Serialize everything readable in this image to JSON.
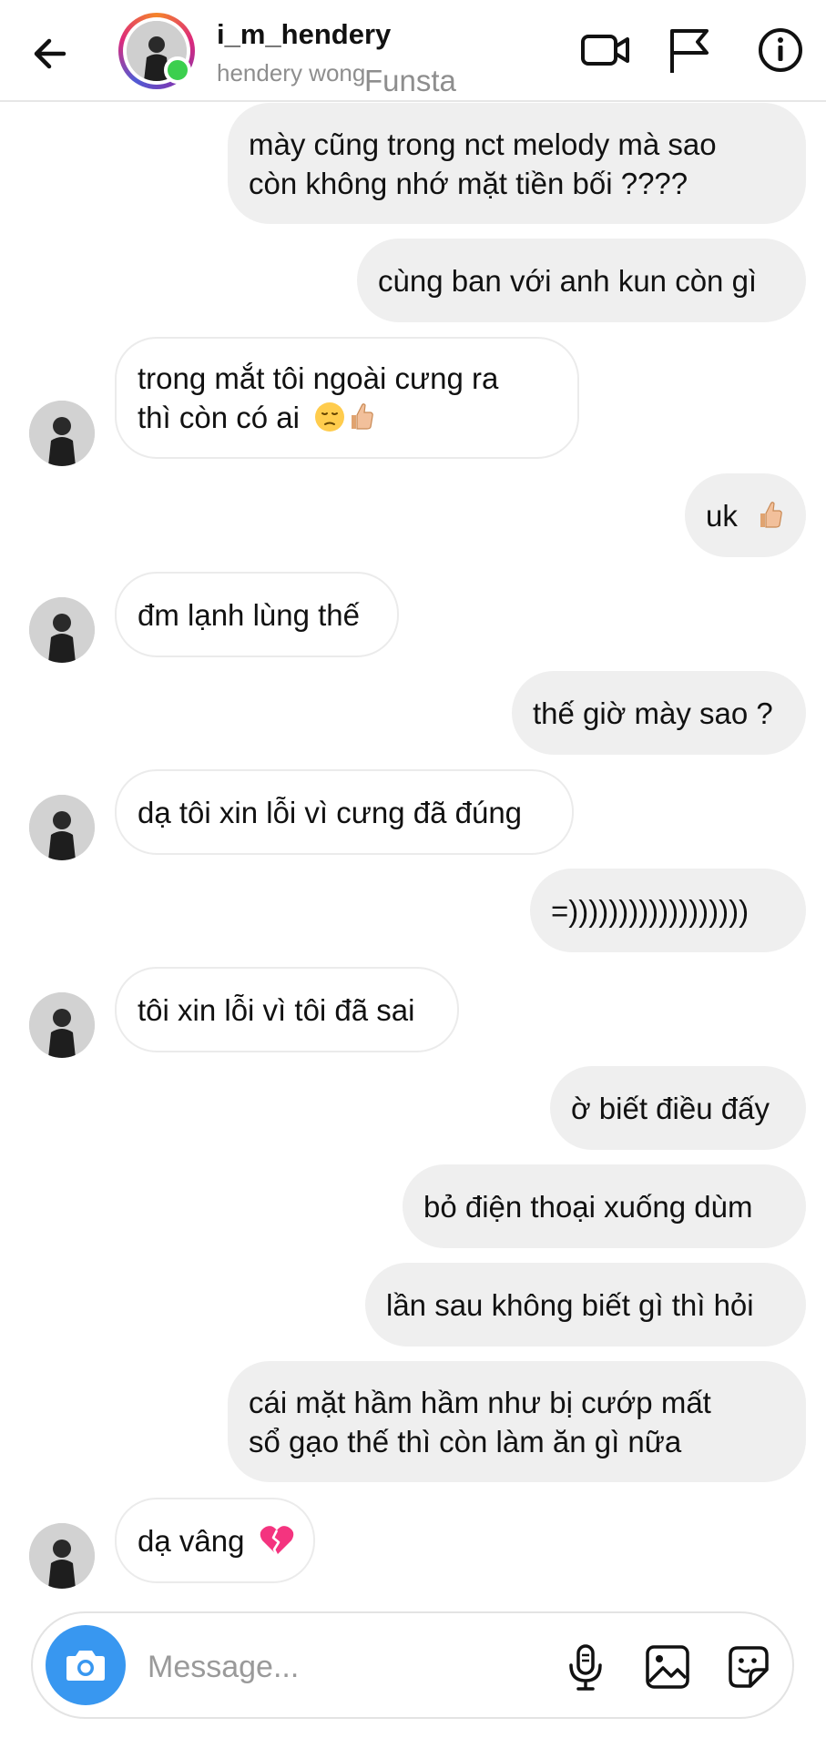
{
  "header": {
    "username": "i_m_hendery",
    "full_name": "hendery wong",
    "watermark": "Funsta",
    "online": true,
    "icons": [
      "back-arrow-icon",
      "video-camera-icon",
      "flag-icon",
      "info-icon"
    ]
  },
  "messages": [
    {
      "sender": "me",
      "lines": [
        "mày cũng trong nct melody mà sao",
        "còn không nhớ mặt tiền bối ????"
      ]
    },
    {
      "sender": "me",
      "lines": [
        "cùng ban với anh kun còn gì"
      ]
    },
    {
      "sender": "them",
      "lines": [
        "trong mắt tôi ngoài cưng ra",
        "thì còn có ai"
      ],
      "emojis": [
        "pensive-face",
        "thumbs-up"
      ]
    },
    {
      "sender": "me",
      "lines": [
        "uk"
      ],
      "emojis": [
        "thumbs-up"
      ]
    },
    {
      "sender": "them",
      "lines": [
        "đm lạnh lùng thế"
      ]
    },
    {
      "sender": "me",
      "lines": [
        "thế giờ mày sao ?"
      ]
    },
    {
      "sender": "them",
      "lines": [
        "dạ tôi xin lỗi vì cưng đã đúng"
      ]
    },
    {
      "sender": "me",
      "lines": [
        "=))))))))))))))))))"
      ]
    },
    {
      "sender": "them",
      "lines": [
        "tôi xin lỗi vì tôi đã sai"
      ]
    },
    {
      "sender": "me",
      "lines": [
        "ờ biết điều đấy"
      ]
    },
    {
      "sender": "me",
      "lines": [
        "bỏ điện thoại xuống dùm"
      ]
    },
    {
      "sender": "me",
      "lines": [
        "lần sau không biết gì thì hỏi"
      ]
    },
    {
      "sender": "me",
      "lines": [
        "cái mặt hầm hầm như bị cướp mất",
        "sổ gạo thế thì còn làm ăn gì nữa"
      ]
    },
    {
      "sender": "them",
      "lines": [
        "dạ vâng"
      ],
      "emojis": [
        "broken-heart"
      ]
    }
  ],
  "composer": {
    "placeholder": "Message...",
    "icons": [
      "camera-icon",
      "microphone-icon",
      "gallery-icon",
      "sticker-icon"
    ]
  },
  "colors": {
    "sent_bubble": "#efefef",
    "camera_button": "#3897f0",
    "online_dot": "#3ccf4e",
    "secondary_text": "#8e8e8e"
  }
}
